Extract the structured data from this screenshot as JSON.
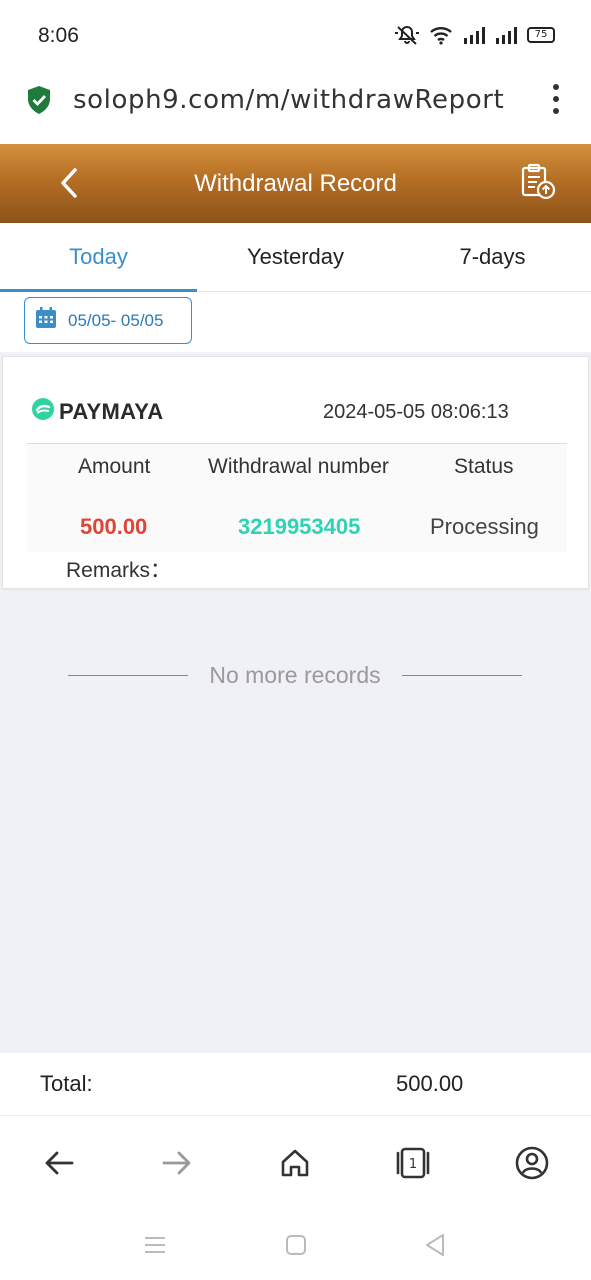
{
  "status_bar": {
    "time": "8:06",
    "battery": "75"
  },
  "browser": {
    "url": "soloph9.com/m/withdrawReport"
  },
  "header": {
    "title": "Withdrawal Record"
  },
  "tabs": [
    {
      "label": "Today",
      "active": true
    },
    {
      "label": "Yesterday",
      "active": false
    },
    {
      "label": "7-days",
      "active": false
    }
  ],
  "date_filter": {
    "label": "05/05- 05/05"
  },
  "records": [
    {
      "method": "PAYMAYA",
      "datetime": "2024-05-05 08:06:13",
      "columns": {
        "amount": "Amount",
        "number": "Withdrawal number",
        "status": "Status"
      },
      "amount": "500.00",
      "withdrawal_number": "3219953405",
      "status": "Processing",
      "remarks_label": "Remarks："
    }
  ],
  "no_more_text": "No more records",
  "total": {
    "label": "Total:",
    "value": "500.00"
  },
  "browser_nav": {
    "tab_count": "1"
  },
  "colors": {
    "header": "#b46f25",
    "accent": "#3a8fc8",
    "amount": "#e04436",
    "number": "#2fd3b4"
  }
}
